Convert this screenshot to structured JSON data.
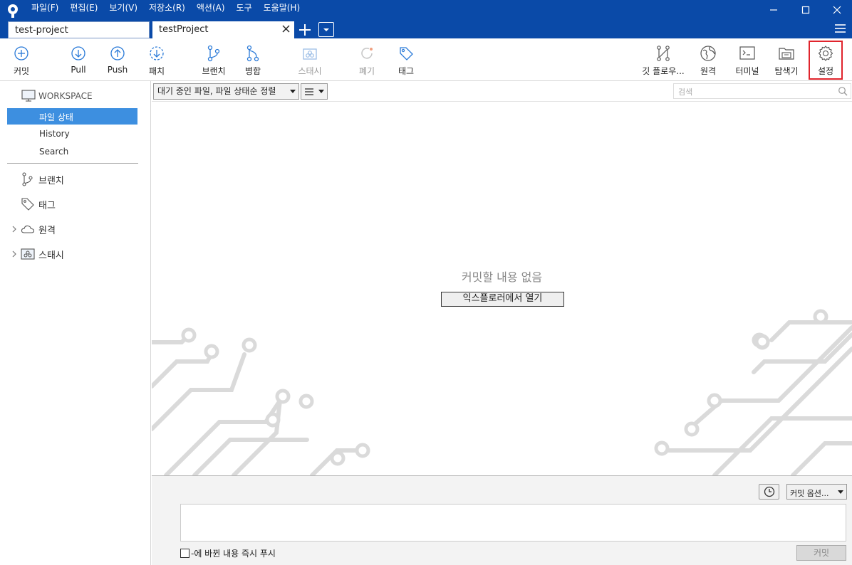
{
  "menu": [
    "파일(F)",
    "편집(E)",
    "보기(V)",
    "저장소(R)",
    "액션(A)",
    "도구",
    "도움말(H)"
  ],
  "tabs": {
    "inactive": "test-project",
    "active": "testProject"
  },
  "toolbar": {
    "commit": "커밋",
    "pull": "Pull",
    "push": "Push",
    "fetch": "패치",
    "branch": "브랜치",
    "merge": "병합",
    "stash": "스태시",
    "discard": "폐기",
    "tag": "태그",
    "gitflow": "깃 플로우...",
    "remote": "원격",
    "terminal": "터미널",
    "explorer": "탐색기",
    "settings": "설정"
  },
  "sidebar": {
    "workspace": "WORKSPACE",
    "sub": [
      "파일 상태",
      "History",
      "Search"
    ],
    "items": [
      "브랜치",
      "태그",
      "원격",
      "스태시"
    ]
  },
  "main": {
    "sort_label": "대기 중인 파일, 파일 상태순 정렬",
    "search_placeholder": "검색",
    "empty_message": "커밋할 내용 없음",
    "open_explorer": "익스플로러에서 열기"
  },
  "commit_area": {
    "options": "커밋 옵션...",
    "push_label": "-에 바뀐 내용 즉시 푸시",
    "commit_button": "커밋"
  },
  "colors": {
    "titlebar": "#0a4aa8",
    "accent": "#3d8fe0",
    "highlight": "#e0242c"
  }
}
